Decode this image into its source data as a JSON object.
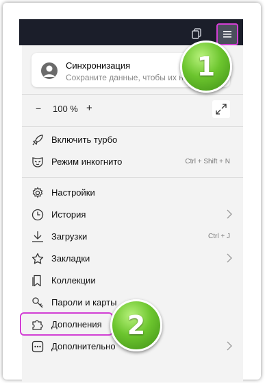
{
  "sync": {
    "title": "Синхронизация",
    "subtitle": "Сохраните данные, чтобы их на"
  },
  "zoom": {
    "minus": "−",
    "value": "100 %",
    "plus": "+"
  },
  "menu": {
    "turbo": "Включить турбо",
    "incognito": "Режим инкогнито",
    "incognito_shortcut": "Ctrl + Shift + N",
    "settings": "Настройки",
    "history": "История",
    "downloads": "Загрузки",
    "downloads_shortcut": "Ctrl + J",
    "bookmarks": "Закладки",
    "collections": "Коллекции",
    "passwords": "Пароли и карты",
    "addons": "Дополнения",
    "more": "Дополнительно"
  },
  "badges": {
    "one": "1",
    "two": "2"
  },
  "colors": {
    "highlight": "#d23fd4",
    "badge_green": "#6cc52e",
    "topbar": "#1b1e2a"
  }
}
